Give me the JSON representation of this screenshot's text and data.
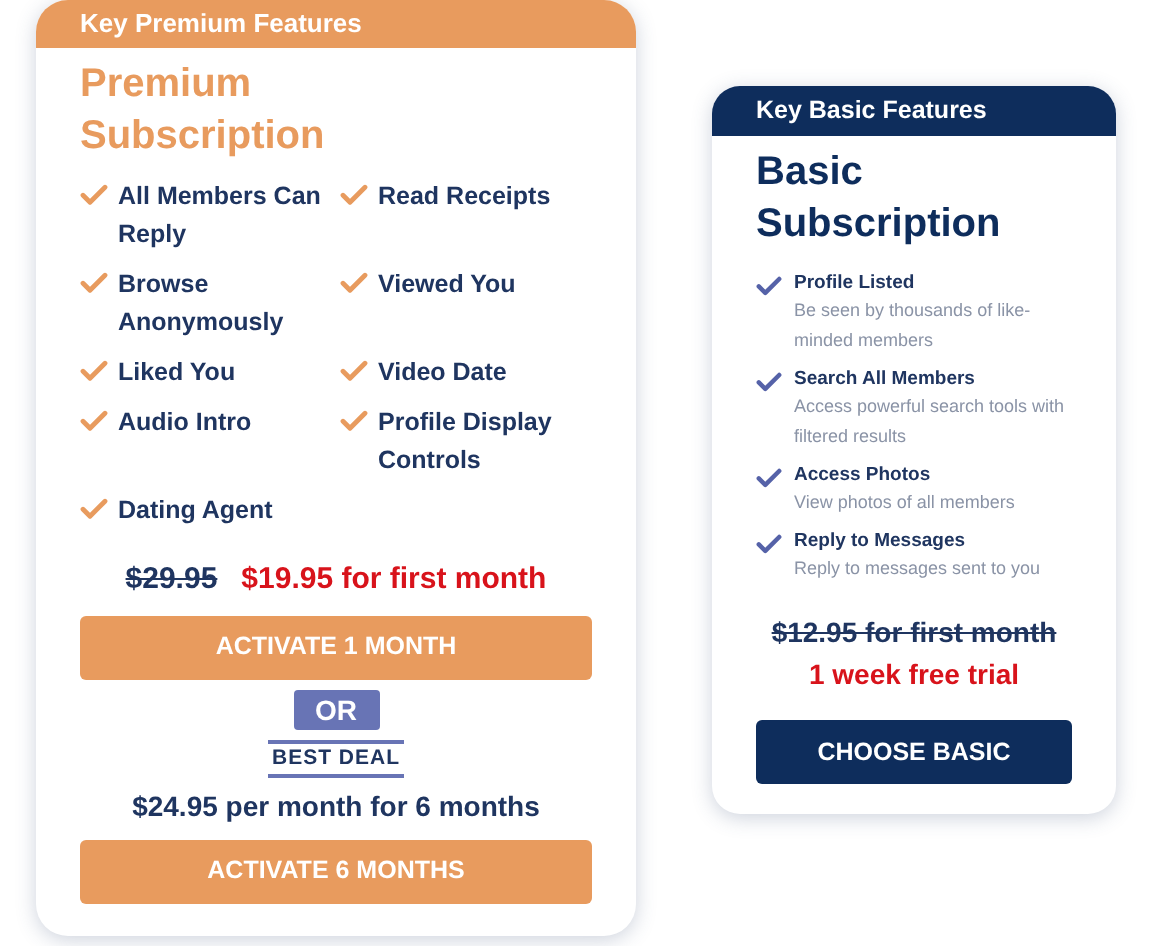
{
  "premium": {
    "header": "Key Premium Features",
    "title": "Premium Subscription",
    "features": [
      "All Members Can Reply",
      "Read Receipts",
      "Browse Anonymously",
      "Viewed You",
      "Liked You",
      "Video Date",
      "Audio Intro",
      "Profile Display Controls",
      "Dating Agent"
    ],
    "old_price": "$29.95",
    "new_price": "$19.95 for first month",
    "button_1": "ACTIVATE 1 MONTH",
    "or": "OR",
    "best_deal": "BEST DEAL",
    "deal_price": "$24.95 per month for 6 months",
    "button_2": "ACTIVATE 6 MONTHS"
  },
  "basic": {
    "header": "Key Basic Features",
    "title": "Basic Subscription",
    "features": [
      {
        "title": "Profile Listed",
        "description": "Be seen by thousands of like-minded members"
      },
      {
        "title": "Search All Members",
        "description": "Access powerful search tools with filtered results"
      },
      {
        "title": "Access Photos",
        "description": "View photos of all members"
      },
      {
        "title": "Reply to Messages",
        "description": "Reply to messages sent to you"
      }
    ],
    "old_price": "$12.95 for first month",
    "trial": "1 week free trial",
    "button": "CHOOSE BASIC"
  }
}
